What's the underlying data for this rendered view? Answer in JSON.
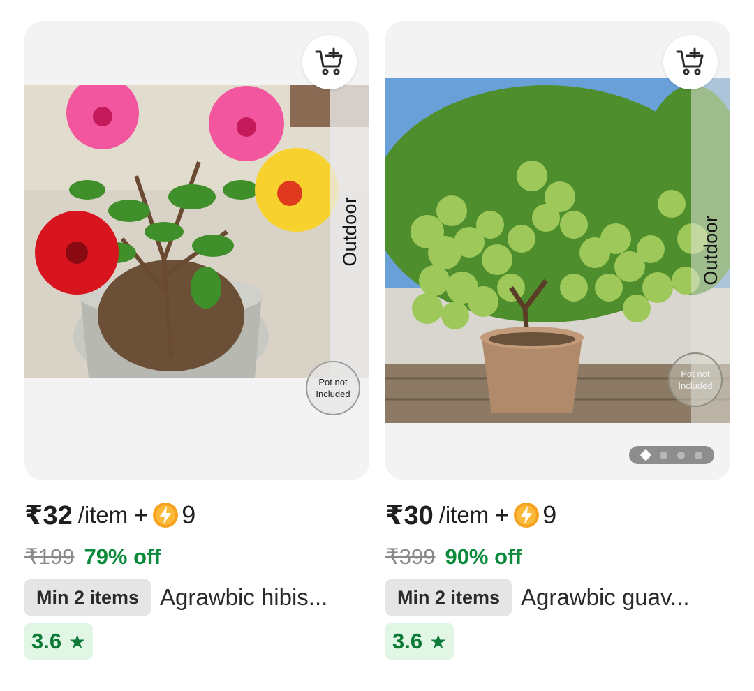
{
  "products": [
    {
      "name": "Agrawbic hibis...",
      "price": "₹32",
      "per_unit": "/item",
      "plus": "+",
      "coins": "9",
      "mrp": "₹199",
      "discount": "79% off",
      "min_qty": "Min 2 items",
      "rating": "3.6",
      "rating_star": "★",
      "tag": "Outdoor",
      "pot_badge": "Pot not Included",
      "icon_cart": "add-to-cart-icon"
    },
    {
      "name": "Agrawbic guav...",
      "price": "₹30",
      "per_unit": "/item",
      "plus": "+",
      "coins": "9",
      "mrp": "₹399",
      "discount": "90% off",
      "min_qty": "Min 2 items",
      "rating": "3.6",
      "rating_star": "★",
      "tag": "Outdoor",
      "pot_badge": "Pot not Included",
      "icon_cart": "add-to-cart-icon",
      "carousel_pages": 4,
      "carousel_active": 1
    }
  ],
  "colors": {
    "discount_green": "#0a8a3a",
    "rating_bg": "#e1f6e5",
    "rating_text": "#0a7a36",
    "mrp_gray": "#8a8a8a",
    "card_bg": "#f3f3f3"
  }
}
